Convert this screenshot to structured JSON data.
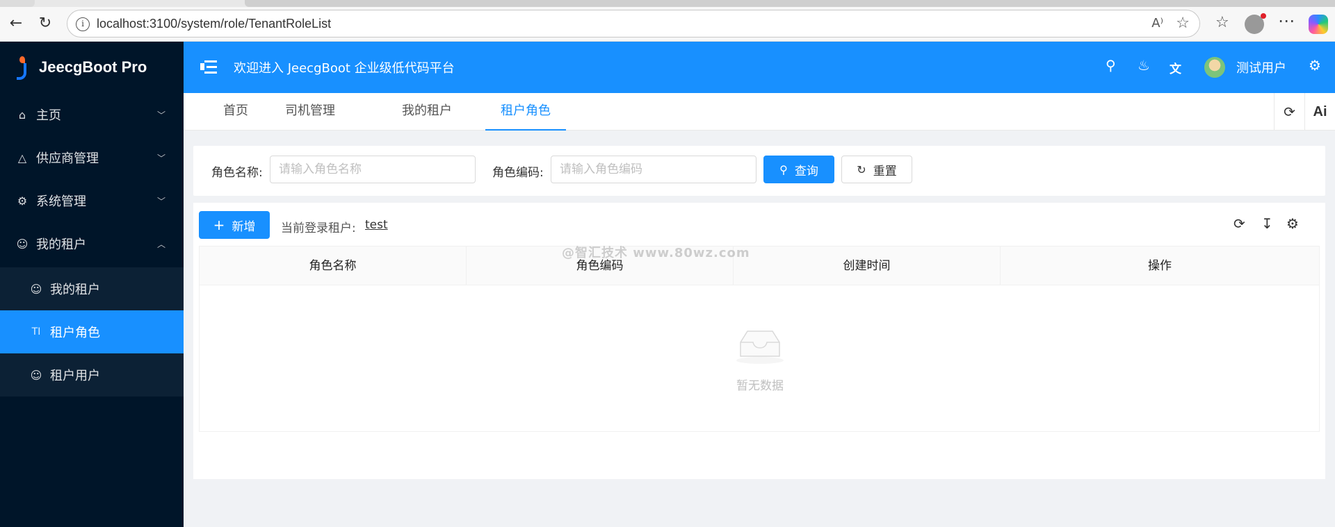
{
  "browser": {
    "url": "localhost:3100/system/role/TenantRoleList",
    "read_aloud_icon": "A⁾",
    "icons": [
      "back-icon",
      "refresh-icon",
      "info-icon",
      "read-aloud-icon",
      "favorite-icon",
      "favorites-bar-icon",
      "profile-icon",
      "more-icon",
      "copilot-icon"
    ]
  },
  "app": {
    "logo_text": "JeecgBoot Pro",
    "welcome": "欢迎进入 JeecgBoot 企业级低代码平台",
    "user_name": "测试用户",
    "accent": "#1890ff",
    "sidebar_bg": "#001529"
  },
  "sidebar": {
    "items": [
      {
        "label": "主页",
        "icon": "home-icon",
        "arrow": "﹀"
      },
      {
        "label": "供应商管理",
        "icon": "supplier-icon",
        "arrow": "﹀"
      },
      {
        "label": "系统管理",
        "icon": "gear-icon",
        "arrow": "﹀"
      },
      {
        "label": "我的租户",
        "icon": "user-icon",
        "arrow": "︿"
      }
    ],
    "subitems": [
      {
        "label": "我的租户",
        "icon": "user-icon"
      },
      {
        "label": "租户角色",
        "icon": "text-icon",
        "icon_text": "TI",
        "active": true
      },
      {
        "label": "租户用户",
        "icon": "user-icon"
      }
    ]
  },
  "tabs": [
    {
      "label": "首页"
    },
    {
      "label": "司机管理"
    },
    {
      "label": "我的租户"
    },
    {
      "label": "租户角色",
      "active": true
    }
  ],
  "tab_tools": {
    "ai_label": "Ai"
  },
  "search": {
    "role_name_label": "角色名称:",
    "role_name_placeholder": "请输入角色名称",
    "role_code_label": "角色编码:",
    "role_code_placeholder": "请输入角色编码",
    "query_label": "查询",
    "reset_label": "重置"
  },
  "table": {
    "add_label": "新增",
    "tenant_label": "当前登录租户:",
    "tenant_value": "test",
    "columns": [
      "角色名称",
      "角色编码",
      "创建时间",
      "操作"
    ],
    "rows": [],
    "empty_text": "暂无数据"
  },
  "watermark": "@智汇技术 www.80wz.com"
}
